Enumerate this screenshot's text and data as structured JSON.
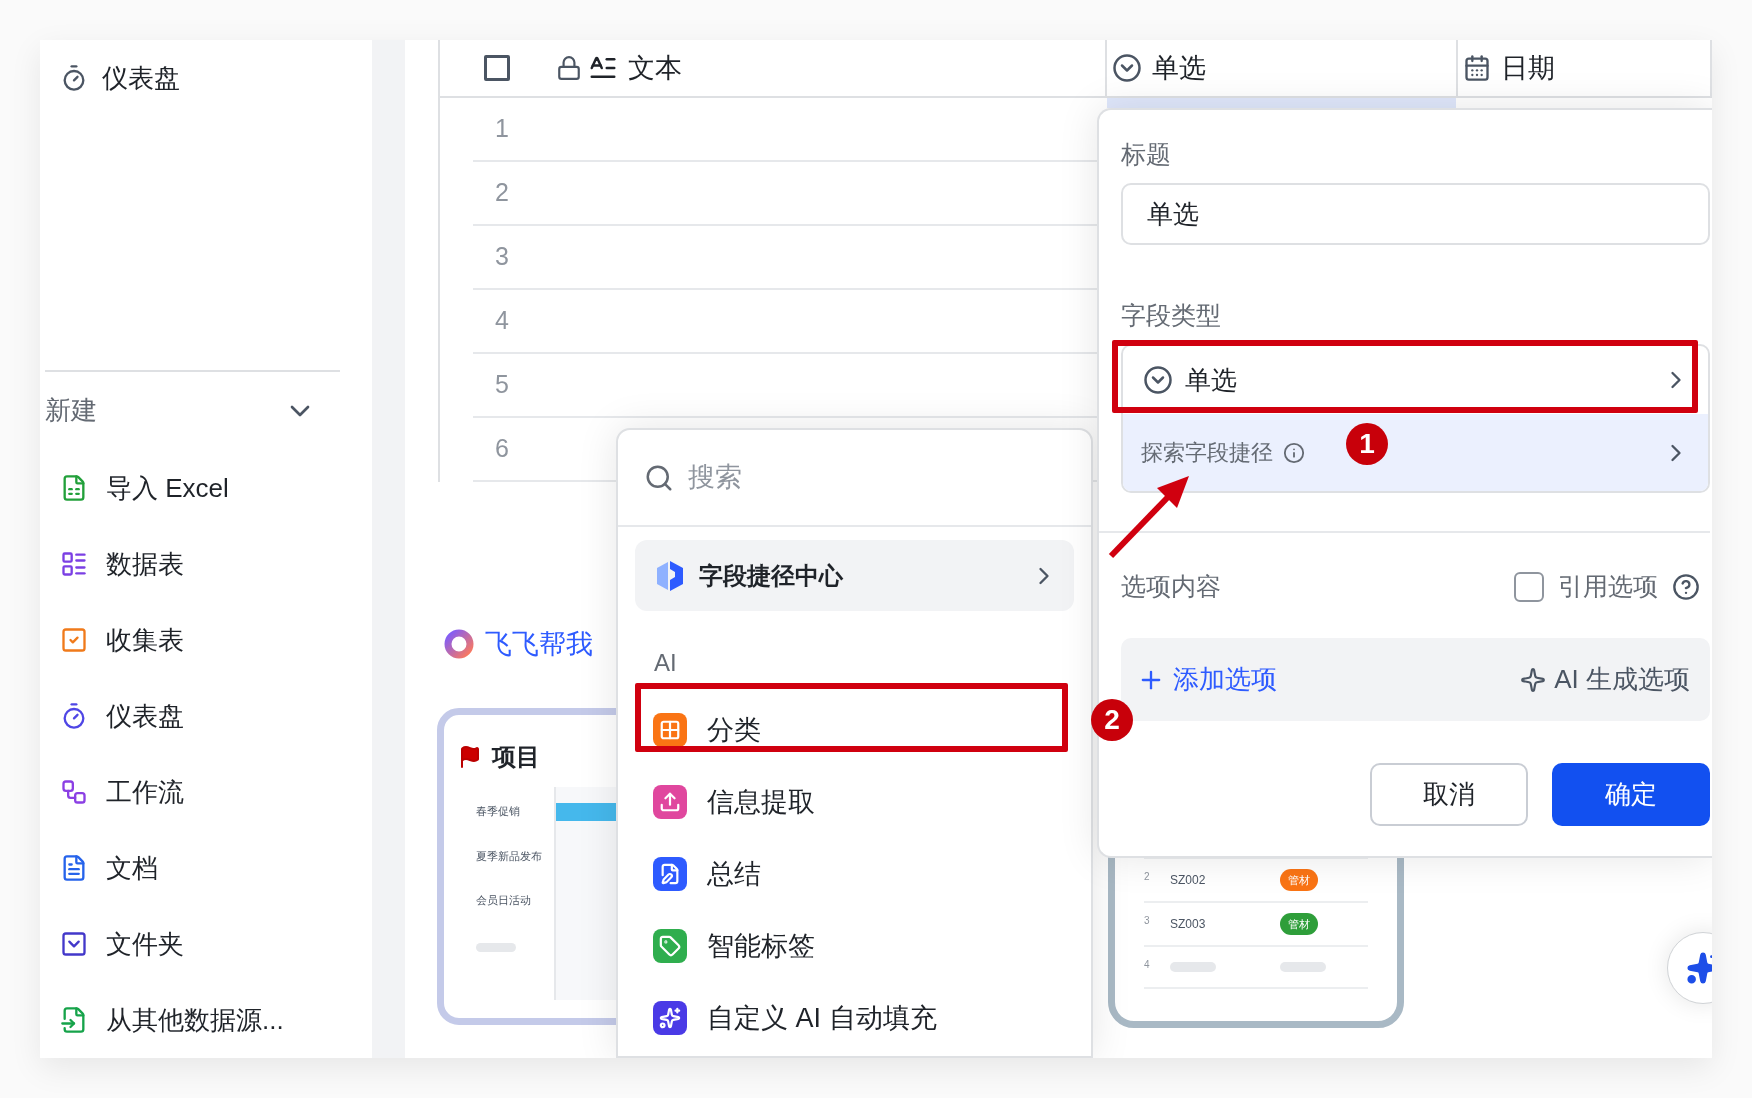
{
  "sidebar": {
    "top_item": {
      "kind": "dashboard",
      "label": "仪表盘"
    },
    "section": {
      "title": "新建",
      "expanded": true
    },
    "items": [
      {
        "kind": "excel",
        "label": "导入 Excel"
      },
      {
        "kind": "table",
        "label": "数据表"
      },
      {
        "kind": "form",
        "label": "收集表"
      },
      {
        "kind": "dashboard",
        "label": "仪表盘"
      },
      {
        "kind": "workflow",
        "label": "工作流"
      },
      {
        "kind": "doc",
        "label": "文档"
      },
      {
        "kind": "folder",
        "label": "文件夹"
      },
      {
        "kind": "import",
        "label": "从其他数据源..."
      }
    ]
  },
  "table": {
    "header_checkbox": {
      "checked": false
    },
    "columns": [
      {
        "kind": "text",
        "label": "文本",
        "locked": true,
        "selected": false
      },
      {
        "kind": "single",
        "label": "单选",
        "locked": false,
        "selected": true
      },
      {
        "kind": "date",
        "label": "日期",
        "locked": false,
        "selected": false
      }
    ],
    "rows": [
      "1",
      "2",
      "3",
      "4",
      "5",
      "6"
    ]
  },
  "assistant_link": "飞飞帮我",
  "project_card": {
    "title": "项目",
    "rows": [
      "春季促销",
      "夏季新品发布",
      "会员日活动"
    ]
  },
  "material_card": {
    "rows": [
      {
        "index": "2",
        "code": "SZ002",
        "tag": "管材",
        "color": "#fa7414"
      },
      {
        "index": "3",
        "code": "SZ003",
        "tag": "管材",
        "color": "#2e9e3a"
      },
      {
        "index": "4"
      }
    ]
  },
  "field_menu": {
    "search_placeholder": "搜索",
    "featured": "字段捷径中心",
    "section": "AI",
    "items": [
      {
        "kind": "classify",
        "label": "分类"
      },
      {
        "kind": "extract",
        "label": "信息提取"
      },
      {
        "kind": "summary",
        "label": "总结"
      },
      {
        "kind": "tag",
        "label": "智能标签"
      },
      {
        "kind": "custom",
        "label": "自定义 AI 自动填充"
      }
    ]
  },
  "field_panel": {
    "title_label": "标题",
    "title_value": "单选",
    "type_label": "字段类型",
    "type_value": "单选",
    "shortcut": "探索字段捷径",
    "options_label": "选项内容",
    "reference": {
      "label": "引用选项",
      "checked": false
    },
    "add_option": "添加选项",
    "ai_generate": "AI 生成选项",
    "buttons": [
      {
        "kind": "secondary",
        "label": "取消"
      },
      {
        "kind": "primary",
        "label": "确定"
      }
    ]
  },
  "annotations": [
    {
      "number": "1"
    },
    {
      "number": "2"
    }
  ]
}
